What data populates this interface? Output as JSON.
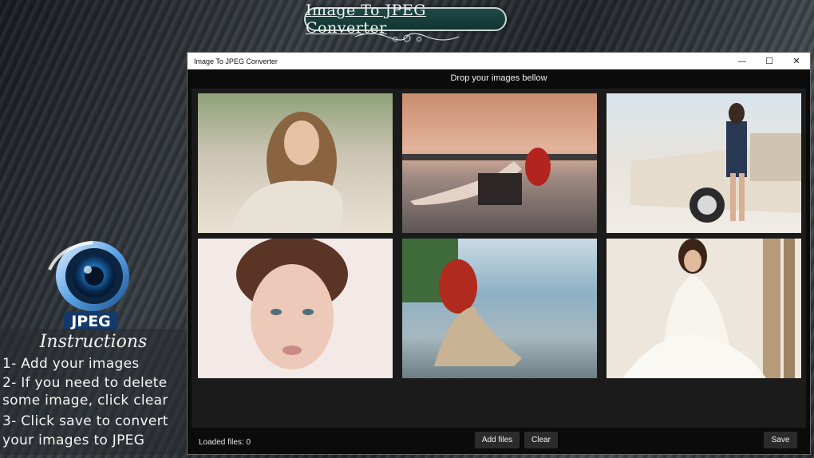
{
  "banner": {
    "title": "Image To JPEG Converter"
  },
  "logo": {
    "text": "JPEG"
  },
  "instructions": {
    "title": "Instructions",
    "lines": [
      "1- Add your images",
      "2- If you need to delete",
      "some image, click clear",
      "3- Click save to convert",
      "your images to JPEG"
    ]
  },
  "window": {
    "title": "Image To JPEG Converter",
    "controls": {
      "minimize": "—",
      "maximize": "☐",
      "close": "✕"
    },
    "drop_label": "Drop your images bellow",
    "loaded_label": "Loaded files: 0",
    "buttons": {
      "add": "Add files",
      "clear": "Clear",
      "save": "Save"
    }
  },
  "colors": {
    "accent": "#1f4a47",
    "window_bg": "#0b0b0b",
    "button_bg": "#2b2b2b"
  }
}
